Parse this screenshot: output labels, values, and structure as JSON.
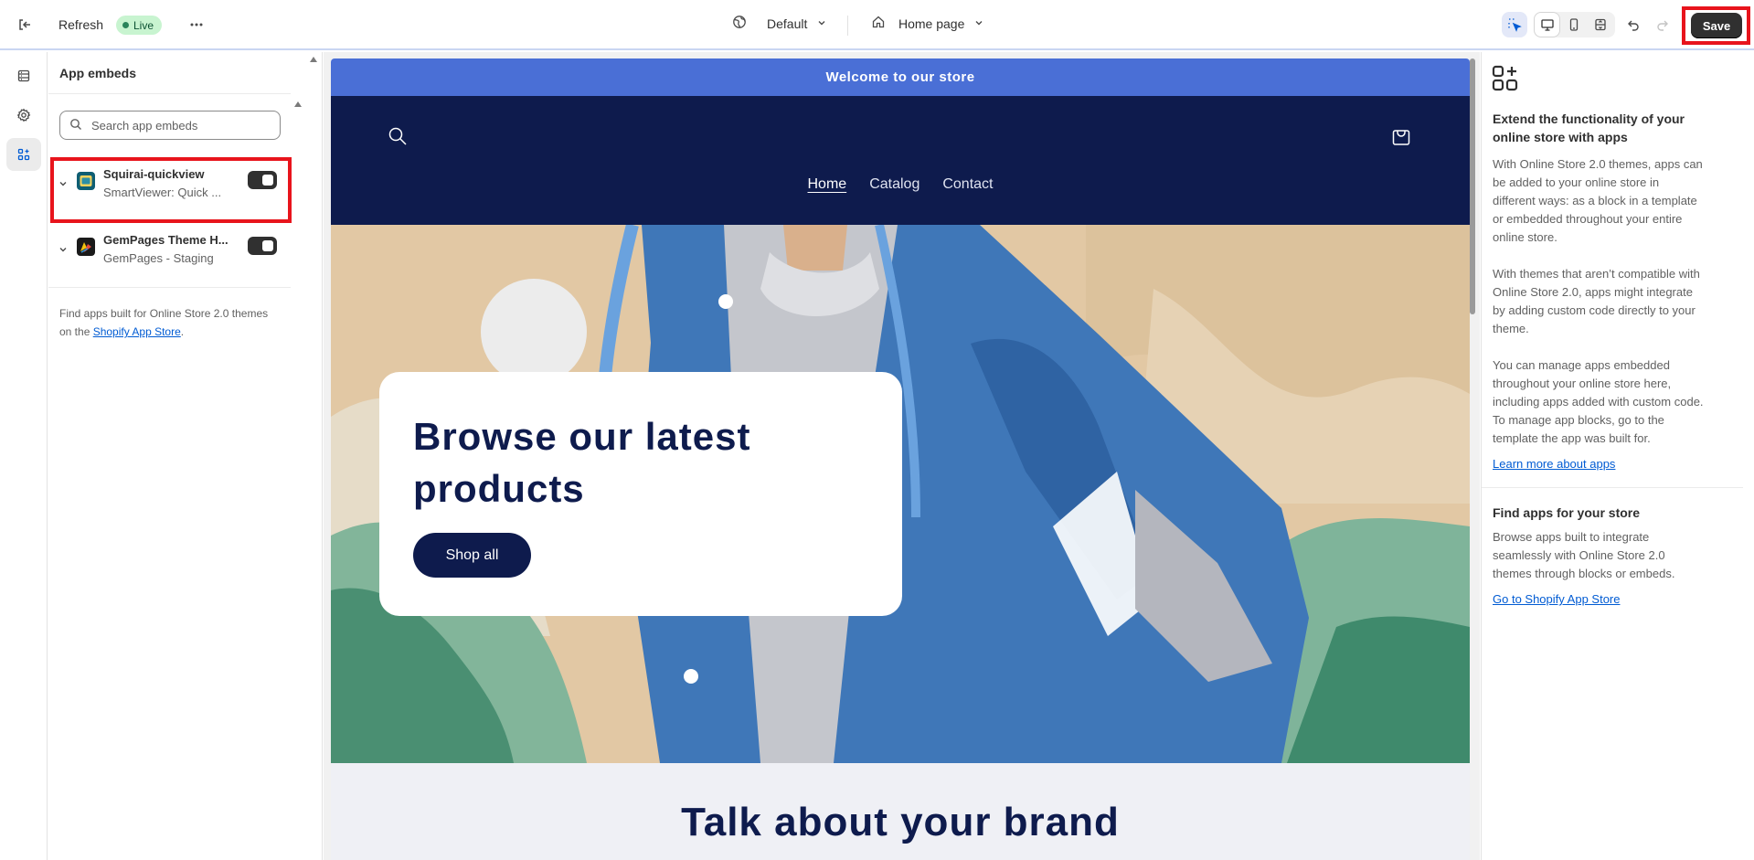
{
  "topbar": {
    "refresh_label": "Refresh",
    "live_label": "Live",
    "theme_label": "Default",
    "page_label": "Home page",
    "save_label": "Save"
  },
  "icons": {
    "exit": "exit-icon",
    "more": "more-icon",
    "globe": "globe-icon",
    "home": "home-icon",
    "chevron": "chevron-down-icon",
    "inspect": "inspect-cursor-icon",
    "desktop": "desktop-icon",
    "mobile": "mobile-icon",
    "fullwidth": "fullwidth-icon",
    "undo": "undo-icon",
    "redo": "redo-icon",
    "sections": "sections-icon",
    "settings": "gear-icon",
    "apps": "apps-icon"
  },
  "panel": {
    "title": "App embeds",
    "search_placeholder": "Search app embeds",
    "embeds": [
      {
        "name": "Squirai-quickview",
        "subtitle": "SmartViewer: Quick ...",
        "enabled": true
      },
      {
        "name": "GemPages Theme H...",
        "subtitle": "GemPages - Staging",
        "enabled": true
      }
    ],
    "find_text": "Find apps built for Online Store 2.0 themes on the ",
    "find_link": "Shopify App Store",
    "find_end": "."
  },
  "store": {
    "announcement": "Welcome to our store",
    "nav": [
      "Home",
      "Catalog",
      "Contact"
    ],
    "hero_title": "Browse our latest products",
    "hero_button": "Shop all",
    "brand_title": "Talk about your brand"
  },
  "info": {
    "heading": "Extend the functionality of your online store with apps",
    "p1": "With Online Store 2.0 themes, apps can be added to your online store in different ways: as a block in a template or embedded throughout your entire online store.",
    "p2": "With themes that aren’t compatible with Online Store 2.0, apps might integrate by adding custom code directly to your theme.",
    "p3": "You can manage apps embedded throughout your online store here, including apps added with custom code. To manage app blocks, go to the template the app was built for.",
    "learn_link": "Learn more about apps",
    "find_heading": "Find apps for your store",
    "find_p": "Browse apps built to integrate seamlessly with Online Store 2.0 themes through blocks or embeds.",
    "store_link": "Go to Shopify App Store"
  },
  "colors": {
    "announcement_bg": "#4a6fd6",
    "header_bg": "#0e1b4d",
    "highlight": "#e8141c",
    "link": "#005bd3"
  }
}
